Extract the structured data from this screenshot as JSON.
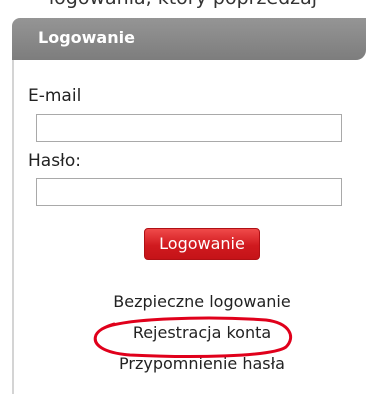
{
  "window": {
    "cropped_top_text": "logowania, który poprzedzaj"
  },
  "login_panel": {
    "title": "Logowanie",
    "email_label": "E-mail",
    "email_value": "",
    "password_label": "Hasło:",
    "password_value": "",
    "submit_label": "Logowanie",
    "links": {
      "secure_login": "Bezpieczne logowanie",
      "register": "Rejestracja konta",
      "password_reminder": "Przypomnienie hasła"
    }
  },
  "colors": {
    "header_gradient_top": "#959595",
    "header_gradient_bottom": "#7d7d7d",
    "button_red": "#d01a1f",
    "highlight_annotation": "#e0001b"
  }
}
